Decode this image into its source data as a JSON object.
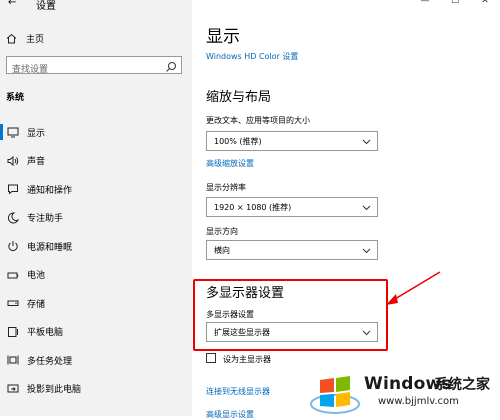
{
  "window": {
    "title": "设置",
    "back_symbol": "←",
    "minimize": "—",
    "maximize": "☐",
    "close": "✕"
  },
  "sidebar": {
    "home_label": "主页",
    "search_placeholder": "查找设置",
    "section": "系统",
    "items": [
      {
        "label": "显示",
        "icon": "monitor-icon",
        "active": true
      },
      {
        "label": "声音",
        "icon": "speaker-icon"
      },
      {
        "label": "通知和操作",
        "icon": "notification-icon"
      },
      {
        "label": "专注助手",
        "icon": "moon-icon"
      },
      {
        "label": "电源和睡眠",
        "icon": "power-icon"
      },
      {
        "label": "电池",
        "icon": "battery-icon"
      },
      {
        "label": "存储",
        "icon": "storage-icon"
      },
      {
        "label": "平板电脑",
        "icon": "tablet-icon"
      },
      {
        "label": "多任务处理",
        "icon": "multitask-icon"
      },
      {
        "label": "投影到此电脑",
        "icon": "project-icon"
      }
    ]
  },
  "main": {
    "title": "显示",
    "hd_color_link": "Windows HD Color 设置",
    "scale_layout_heading": "缩放与布局",
    "scale_label": "更改文本、应用等项目的大小",
    "scale_value": "100% (推荐)",
    "advanced_scaling_link": "高级缩放设置",
    "resolution_label": "显示分辨率",
    "resolution_value": "1920 × 1080 (推荐)",
    "orientation_label": "显示方向",
    "orientation_value": "横向",
    "multi_display_heading": "多显示器设置",
    "multi_display_label": "多显示器设置",
    "multi_display_value": "扩展这些显示器",
    "main_display_checkbox": "设为主显示器",
    "wireless_link": "连接到无线显示器",
    "advanced_display_link": "高级显示设置"
  },
  "watermark": {
    "brand": "Windows",
    "cn": "系统之家",
    "url": "www.bjjmlv.com"
  },
  "colors": {
    "accent": "#0078d7",
    "link": "#0067b8",
    "highlight": "#e00000",
    "sidebar_bg": "#f2f2f2"
  }
}
